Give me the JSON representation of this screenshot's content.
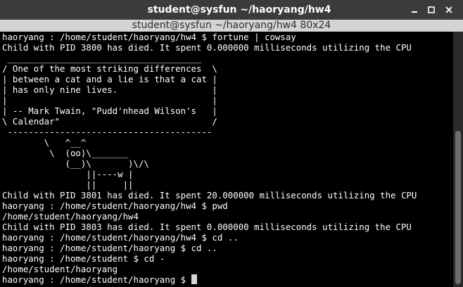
{
  "window": {
    "title": "student@sysfun ~/haoryang/hw4",
    "tab_title": "student@sysfun ~/haoryang/hw4 80x24",
    "controls": {
      "minimize_icon": "minimize-icon",
      "maximize_icon": "maximize-icon",
      "close_icon": "close-icon"
    }
  },
  "terminal": {
    "lines": [
      "haoryang : /home/student/haoryang/hw4 $ fortune | cowsay",
      "Child with PID 3800 has died. It spent 0.000000 milliseconds utilizing the CPU",
      " _____________________________________",
      "/ One of the most striking differences  \\",
      "| between a cat and a lie is that a cat |",
      "| has only nine lives.                  |",
      "|                                       |",
      "| -- Mark Twain, \"Pudd'nhead Wilson's   |",
      "\\ Calendar\"                             /",
      " ---------------------------------------",
      "        \\   ^__^",
      "         \\  (oo)\\_______",
      "            (__)\\       )\\/\\",
      "                ||----w |",
      "                ||     ||",
      "Child with PID 3801 has died. It spent 20.000000 milliseconds utilizing the CPU",
      "haoryang : /home/student/haoryang/hw4 $ pwd",
      "/home/student/haoryang/hw4",
      "Child with PID 3803 has died. It spent 0.000000 milliseconds utilizing the CPU",
      "haoryang : /home/student/haoryang/hw4 $ cd ..",
      "haoryang : /home/student/haoryang $ cd ..",
      "haoryang : /home/student $ cd -",
      "/home/student/haoryang"
    ],
    "prompt": "haoryang : /home/student/haoryang $ ",
    "scroll_position": 0.35
  },
  "colors": {
    "background": "#000000",
    "foreground": "#ffffff",
    "titlebar": "#3b3b3b",
    "tabbar": "#d4d4d4"
  }
}
